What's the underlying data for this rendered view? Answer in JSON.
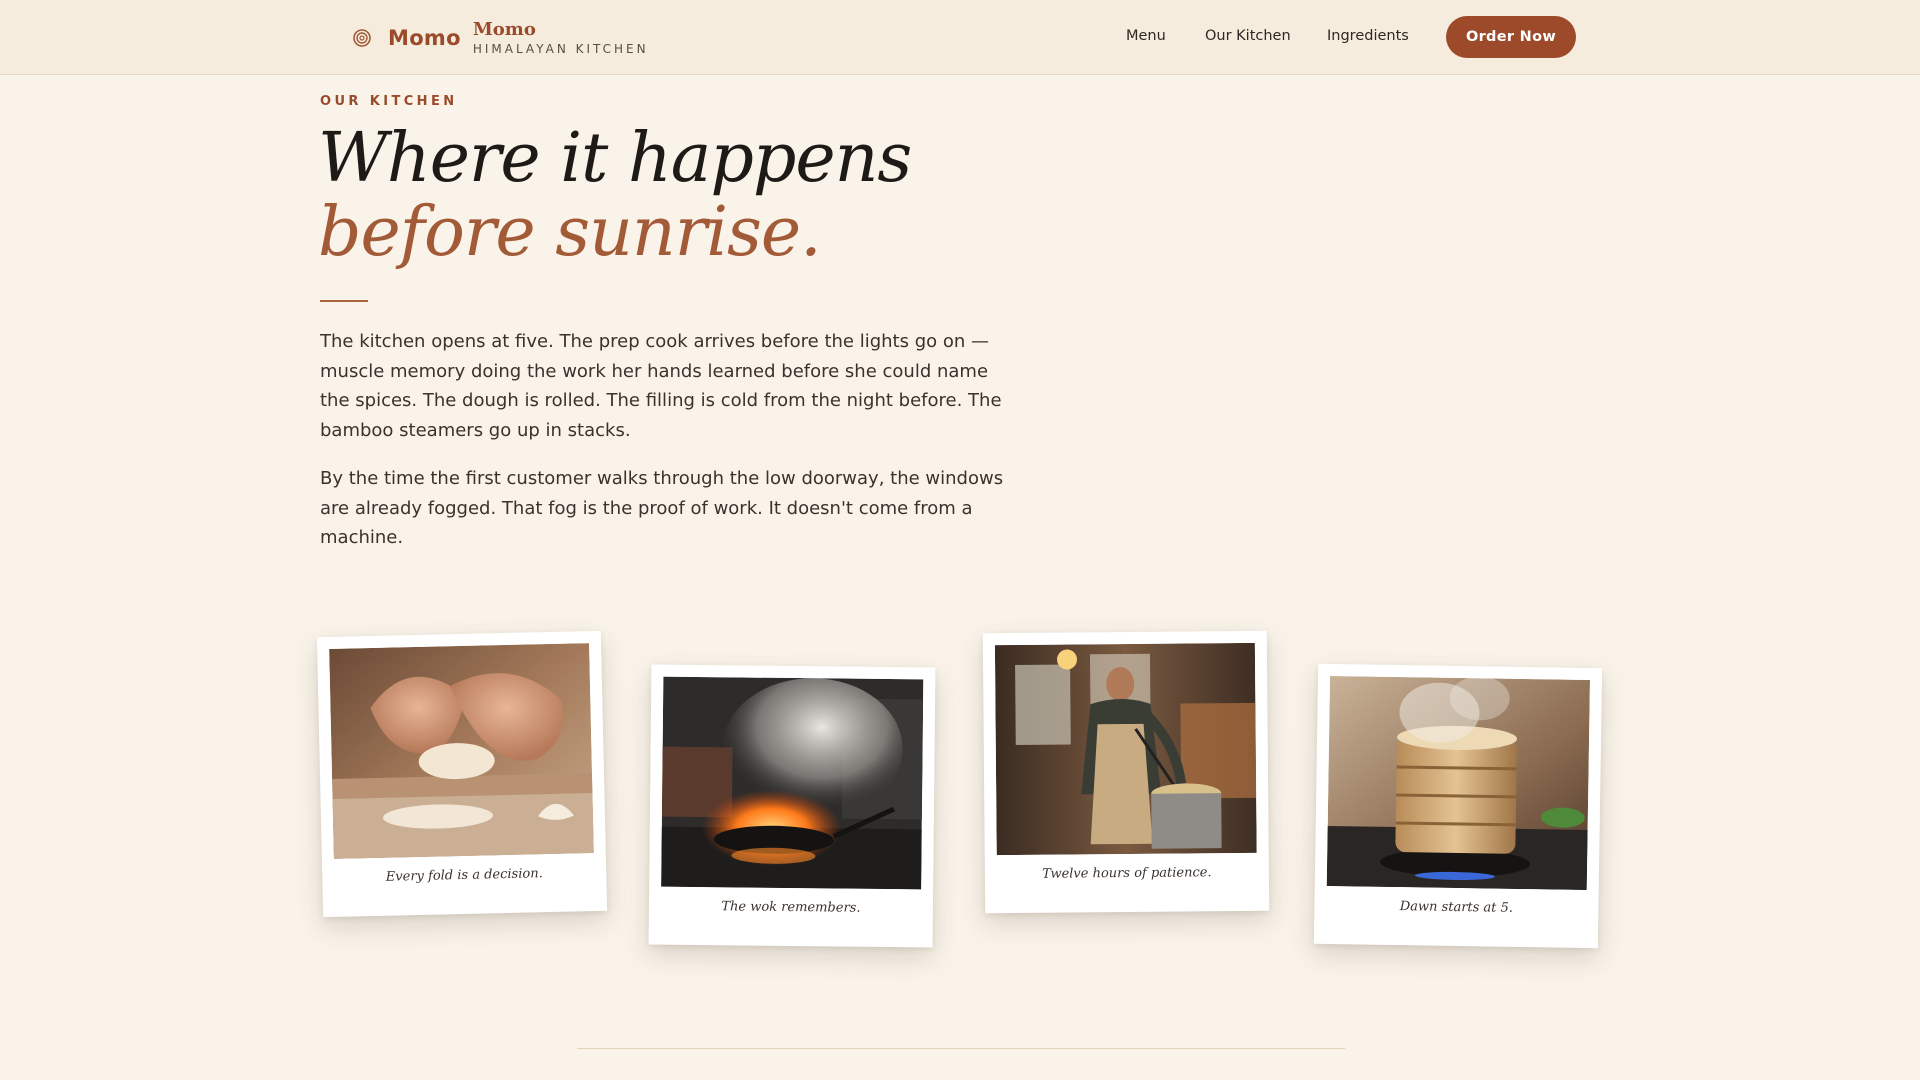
{
  "header": {
    "brand_name": "Momo",
    "brand_title": "Momo",
    "brand_subtitle": "HIMALAYAN KITCHEN",
    "nav": [
      {
        "label": "Menu"
      },
      {
        "label": "Our Kitchen"
      },
      {
        "label": "Ingredients"
      }
    ],
    "order_label": "Order Now",
    "brand_icon": "spiral-icon"
  },
  "hero": {
    "eyebrow": "OUR KITCHEN",
    "title_line1": "Where it happens",
    "title_line2": "before sunrise.",
    "paragraphs": [
      "The kitchen opens at five. The prep cook arrives before the lights go on — muscle memory doing the work her hands learned before she could name the spices. The dough is rolled. The filling is cold from the night before. The bamboo steamers go up in stacks.",
      "By the time the first customer walks through the low doorway, the windows are already fogged. That fog is the proof of work. It doesn't come from a machine."
    ]
  },
  "gallery": [
    {
      "caption": "Every fold is a decision."
    },
    {
      "caption": "The wok remembers."
    },
    {
      "caption": "Twelve hours of patience."
    },
    {
      "caption": "Dawn starts at 5."
    }
  ],
  "colors": {
    "accent": "#9c4a2a",
    "accent_text": "#a25a37",
    "background": "#f9f3ea",
    "header_bg": "#f5ecdd"
  }
}
